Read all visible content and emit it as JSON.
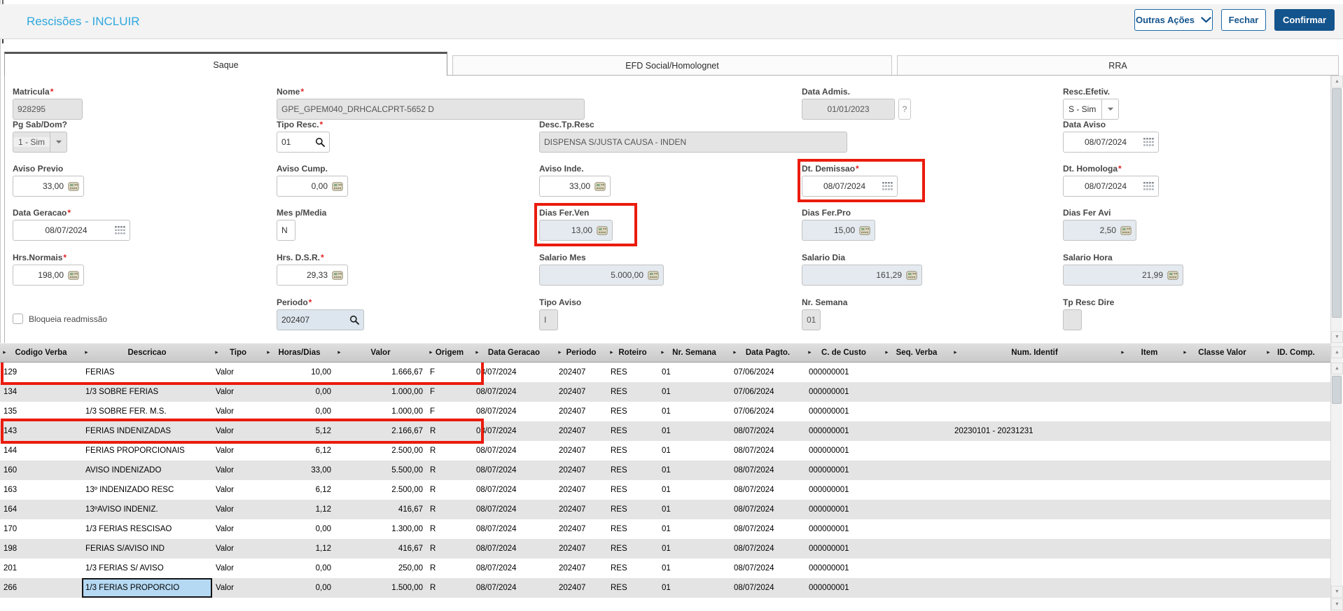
{
  "window": {
    "title": "Rescisões - INCLUIR"
  },
  "header_buttons": {
    "outras_acoes": "Outras Ações",
    "fechar": "Fechar",
    "confirmar": "Confirmar"
  },
  "tabs": [
    {
      "label": "Saque",
      "active": true
    },
    {
      "label": "EFD Social/Homolognet",
      "active": false
    },
    {
      "label": "RRA",
      "active": false
    }
  ],
  "fields": {
    "matricula": {
      "label": "Matricula",
      "required": true,
      "value": "928295"
    },
    "nome": {
      "label": "Nome",
      "required": true,
      "value": "GPE_GPEM040_DRHCALCPRT-5652 D"
    },
    "data_admis": {
      "label": "Data Admis.",
      "value": "01/01/2023",
      "helper": "?"
    },
    "resc_efetiv": {
      "label": "Resc.Efetiv.",
      "value": "S - Sim"
    },
    "pg_sab_dom": {
      "label": "Pg Sab/Dom?",
      "value": "1 - Sim"
    },
    "tipo_resc": {
      "label": "Tipo Resc.",
      "required": true,
      "value": "01"
    },
    "desc_tp_resc": {
      "label": "Desc.Tp.Resc",
      "value": "DISPENSA S/JUSTA CAUSA - INDEN"
    },
    "data_aviso": {
      "label": "Data Aviso",
      "value": "08/07/2024"
    },
    "aviso_previo": {
      "label": "Aviso Previo",
      "value": "33,00"
    },
    "aviso_cump": {
      "label": "Aviso Cump.",
      "value": "0,00"
    },
    "aviso_inde": {
      "label": "Aviso Inde.",
      "value": "33,00"
    },
    "dt_demissao": {
      "label": "Dt. Demissao",
      "required": true,
      "value": "08/07/2024"
    },
    "dt_homologa": {
      "label": "Dt. Homologa",
      "required": true,
      "value": "08/07/2024"
    },
    "data_geracao": {
      "label": "Data Geracao",
      "required": true,
      "value": "08/07/2024"
    },
    "mes_p_media": {
      "label": "Mes p/Media",
      "value": "N"
    },
    "dias_fer_ven": {
      "label": "Dias Fer.Ven",
      "value": "13,00"
    },
    "dias_fer_pro": {
      "label": "Dias Fer.Pro",
      "value": "15,00"
    },
    "dias_fer_avi": {
      "label": "Dias Fer Avi",
      "value": "2,50"
    },
    "hrs_normais": {
      "label": "Hrs.Normais",
      "required": true,
      "value": "198,00"
    },
    "hrs_dsr": {
      "label": "Hrs. D.S.R.",
      "required": true,
      "value": "29,33"
    },
    "salario_mes": {
      "label": "Salario Mes",
      "value": "5.000,00"
    },
    "salario_dia": {
      "label": "Salario Dia",
      "value": "161,29"
    },
    "salario_hora": {
      "label": "Salario Hora",
      "value": "21,99"
    },
    "bloqueia_readmissao": {
      "label": "Bloqueia readmissão",
      "checked": false
    },
    "periodo": {
      "label": "Periodo",
      "required": true,
      "value": "202407"
    },
    "tipo_aviso": {
      "label": "Tipo Aviso",
      "value": "I"
    },
    "nr_semana": {
      "label": "Nr. Semana",
      "value": "01"
    },
    "tp_resc_dire": {
      "label": "Tp Resc Dire",
      "value": ""
    }
  },
  "grid": {
    "columns": [
      "Codigo Verba",
      "Descricao",
      "Tipo",
      "Horas/Dias",
      "Valor",
      "Origem",
      "Data Geracao",
      "Periodo",
      "Roteiro",
      "Nr. Semana",
      "Data Pagto.",
      "C. de Custo",
      "Seq. Verba",
      "Num. Identif",
      "Item",
      "Classe Valor",
      "ID. Comp."
    ],
    "rows": [
      [
        "129",
        "FERIAS",
        "Valor",
        "10,00",
        "1.666,67",
        "F",
        "08/07/2024",
        "202407",
        "RES",
        "01",
        "07/06/2024",
        "000000001",
        "",
        "",
        "",
        "",
        ""
      ],
      [
        "134",
        "1/3 SOBRE FERIAS",
        "Valor",
        "0,00",
        "1.000,00",
        "F",
        "08/07/2024",
        "202407",
        "RES",
        "01",
        "07/06/2024",
        "000000001",
        "",
        "",
        "",
        "",
        ""
      ],
      [
        "135",
        "1/3 SOBRE FER. M.S.",
        "Valor",
        "0,00",
        "1.000,00",
        "F",
        "08/07/2024",
        "202407",
        "RES",
        "01",
        "07/06/2024",
        "000000001",
        "",
        "",
        "",
        "",
        ""
      ],
      [
        "143",
        "FERIAS INDENIZADAS",
        "Valor",
        "5,12",
        "2.166,67",
        "R",
        "08/07/2024",
        "202407",
        "RES",
        "01",
        "08/07/2024",
        "000000001",
        "",
        "20230101 - 20231231",
        "",
        "",
        ""
      ],
      [
        "144",
        "FERIAS PROPORCIONAIS",
        "Valor",
        "6,12",
        "2.500,00",
        "R",
        "08/07/2024",
        "202407",
        "RES",
        "01",
        "08/07/2024",
        "000000001",
        "",
        "",
        "",
        "",
        ""
      ],
      [
        "160",
        "AVISO INDENIZADO",
        "Valor",
        "33,00",
        "5.500,00",
        "R",
        "08/07/2024",
        "202407",
        "RES",
        "01",
        "08/07/2024",
        "000000001",
        "",
        "",
        "",
        "",
        ""
      ],
      [
        "163",
        "13º INDENIZADO RESC",
        "Valor",
        "6,12",
        "2.500,00",
        "R",
        "08/07/2024",
        "202407",
        "RES",
        "01",
        "08/07/2024",
        "000000001",
        "",
        "",
        "",
        "",
        ""
      ],
      [
        "164",
        "13ºAVISO INDENIZ.",
        "Valor",
        "1,12",
        "416,67",
        "R",
        "08/07/2024",
        "202407",
        "RES",
        "01",
        "08/07/2024",
        "000000001",
        "",
        "",
        "",
        "",
        ""
      ],
      [
        "170",
        "1/3 FERIAS RESCISAO",
        "Valor",
        "0,00",
        "1.300,00",
        "R",
        "08/07/2024",
        "202407",
        "RES",
        "01",
        "08/07/2024",
        "000000001",
        "",
        "",
        "",
        "",
        ""
      ],
      [
        "198",
        "FERIAS S/AVISO IND",
        "Valor",
        "1,12",
        "416,67",
        "R",
        "08/07/2024",
        "202407",
        "RES",
        "01",
        "08/07/2024",
        "000000001",
        "",
        "",
        "",
        "",
        ""
      ],
      [
        "201",
        "1/3 FERIAS S/ AVISO",
        "Valor",
        "0,00",
        "250,00",
        "R",
        "08/07/2024",
        "202407",
        "RES",
        "01",
        "08/07/2024",
        "000000001",
        "",
        "",
        "",
        "",
        ""
      ],
      [
        "266",
        "1/3 FERIAS PROPORCIO",
        "Valor",
        "0,00",
        "1.500,00",
        "R",
        "08/07/2024",
        "202407",
        "RES",
        "01",
        "08/07/2024",
        "000000001",
        "",
        "",
        "",
        "",
        ""
      ]
    ],
    "highlighted_rows": [
      0,
      3
    ],
    "selected_cell": {
      "row": 11,
      "col": 1
    }
  },
  "colors": {
    "accent": "#2da7de",
    "primary": "#14548c",
    "highlight": "#ea1c0d",
    "stripe": "#e4e4e4"
  }
}
